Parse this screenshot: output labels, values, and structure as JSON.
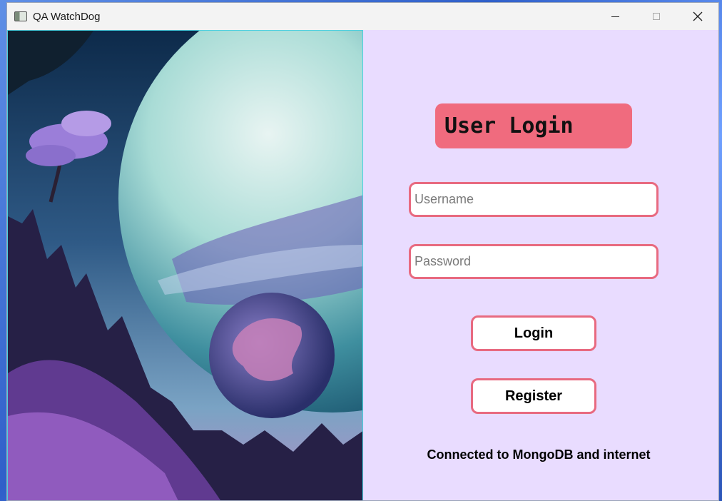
{
  "window": {
    "title": "QA WatchDog",
    "controls": {
      "minimize": "minimize-icon",
      "maximize": "maximize-icon",
      "close": "close-icon"
    }
  },
  "login": {
    "heading": "User Login",
    "username_placeholder": "Username",
    "username_value": "",
    "password_placeholder": "Password",
    "password_value": "",
    "login_label": "Login",
    "register_label": "Register",
    "status_text": "Connected to MongoDB and internet"
  },
  "colors": {
    "panel_bg": "#e9dcff",
    "accent": "#f06b7e",
    "field_border": "#e86a80"
  }
}
